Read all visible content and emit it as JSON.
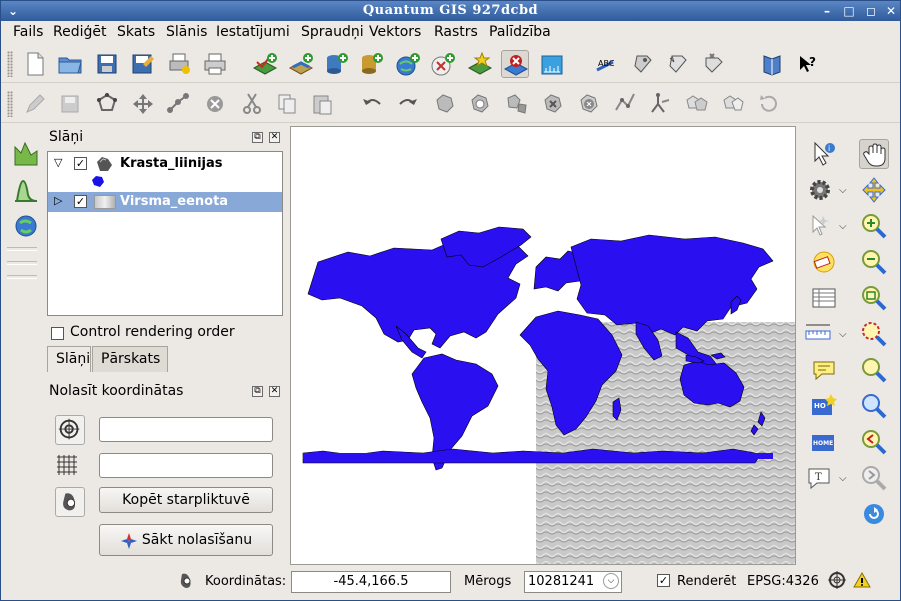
{
  "window": {
    "title": "Quantum GIS 927dcbd"
  },
  "menubar": [
    "Fails",
    "Rediģēt",
    "Skats",
    "Slānis",
    "Iestatījumi",
    "Spraudņi",
    "Vektors",
    "Rastrs",
    "Palīdzība"
  ],
  "layers_panel": {
    "title": "Slāņi",
    "layers": [
      {
        "name": "Krasta_liinijas",
        "checked": true,
        "expanded": true,
        "symbol_color": "#1a10e8"
      },
      {
        "name": "Virsma_eenota",
        "checked": true,
        "expanded": false,
        "selected": true
      }
    ],
    "control_rendering_order": {
      "label": "Control rendering order",
      "checked": false
    },
    "tabs": [
      "Slāņi",
      "Pārskats"
    ],
    "active_tab": "Slāņi"
  },
  "coordinate_panel": {
    "title": "Nolasīt koordinātas",
    "field_1": "",
    "field_2": "",
    "copy_button": "Kopēt starpliktuvē",
    "start_button": "Sākt nolasīšanu"
  },
  "statusbar": {
    "coordinates_label": "Koordinātas:",
    "coordinates_value": "-45.4,166.5",
    "scale_label": "Mērogs",
    "scale_value": "10281241",
    "render_label": "Renderēt",
    "render_checked": true,
    "crs": "EPSG:4326"
  },
  "colors": {
    "land": "#2a10f0",
    "selection": "#88a8d8",
    "titlebar": "#3a66a8"
  }
}
